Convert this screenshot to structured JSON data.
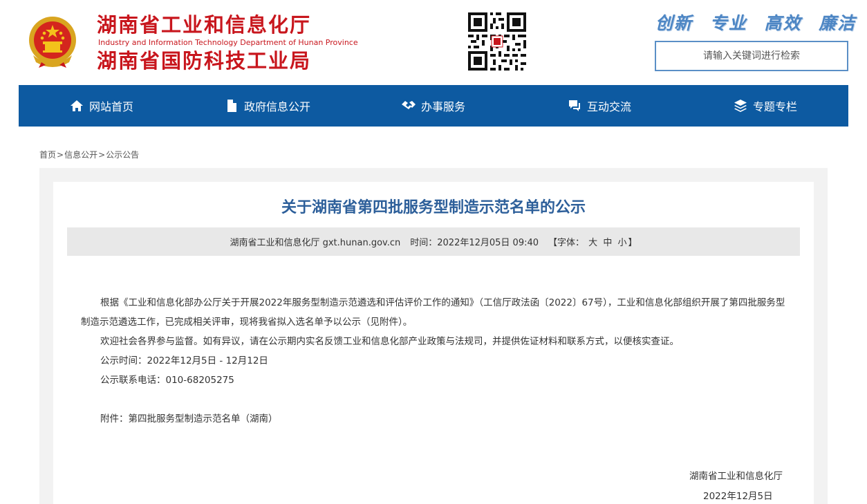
{
  "header": {
    "title_main": "湖南省工业和信息化厅",
    "title_en": "Industry and Information Technology Department of Hunan Province",
    "title_sub": "湖南省国防科技工业局",
    "slogan": [
      "创新",
      "专业",
      "高效",
      "廉洁"
    ],
    "search_placeholder": "请输入关键词进行检索"
  },
  "nav": {
    "items": [
      {
        "label": "网站首页",
        "icon": "home-icon"
      },
      {
        "label": "政府信息公开",
        "icon": "document-icon"
      },
      {
        "label": "办事服务",
        "icon": "handshake-icon"
      },
      {
        "label": "互动交流",
        "icon": "chat-icon"
      },
      {
        "label": "专题专栏",
        "icon": "layers-icon"
      }
    ]
  },
  "breadcrumb": {
    "items": [
      "首页",
      "信息公开",
      "公示公告"
    ],
    "separator": ">"
  },
  "article": {
    "title": "关于湖南省第四批服务型制造示范名单的公示",
    "meta": {
      "source": "湖南省工业和信息化厅 gxt.hunan.gov.cn",
      "time": "时间：2022年12月05日 09:40",
      "font_label": "【字体：",
      "font_big": "大",
      "font_mid": "中",
      "font_small": "小",
      "font_end": "】"
    },
    "paragraphs": [
      "根据《工业和信息化部办公厅关于开展2022年服务型制造示范遴选和评估评价工作的通知》（工信厅政法函〔2022〕67号），工业和信息化部组织开展了第四批服务型制造示范遴选工作，已完成相关评审，现将我省拟入选名单予以公示（见附件）。",
      "欢迎社会各界参与监督。如有异议，请在公示期内实名反馈工业和信息化部产业政策与法规司，并提供佐证材料和联系方式，以便核实查证。",
      "公示时间：2022年12月5日 - 12月12日",
      "公示联系电话：010-68205275"
    ],
    "attachment": "附件：第四批服务型制造示范名单（湖南）",
    "signature": "湖南省工业和信息化厅",
    "date": "2022年12月5日"
  }
}
